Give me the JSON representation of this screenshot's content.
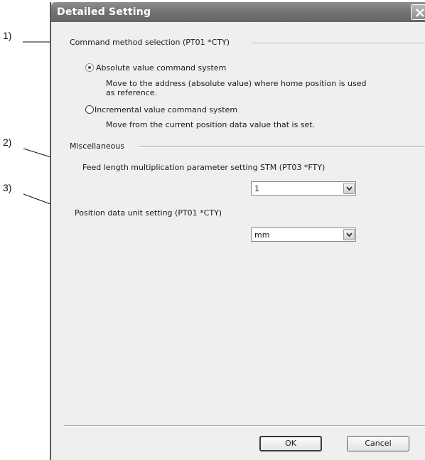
{
  "window": {
    "title": "Detailed Setting"
  },
  "command_group": {
    "label": "Command method selection (PT01 *CTY)",
    "options": [
      {
        "label": "Absolute value command system",
        "description_line1": "Move to the address (absolute value) where home position is used",
        "description_line2": "as reference.",
        "selected": true
      },
      {
        "label": "Incremental value command system",
        "description_line1": "Move from the current position data value that is set.",
        "selected": false
      }
    ]
  },
  "misc_group": {
    "label": "Miscellaneous",
    "feed_length": {
      "label": "Feed length multiplication parameter setting STM (PT03 *FTY)",
      "value": "1"
    },
    "position_unit": {
      "label": "Position data unit setting (PT01 *CTY)",
      "value": "mm"
    }
  },
  "buttons": {
    "ok": "OK",
    "cancel": "Cancel"
  },
  "callouts": {
    "c1": "1)",
    "c2": "2)",
    "c3": "3)"
  }
}
